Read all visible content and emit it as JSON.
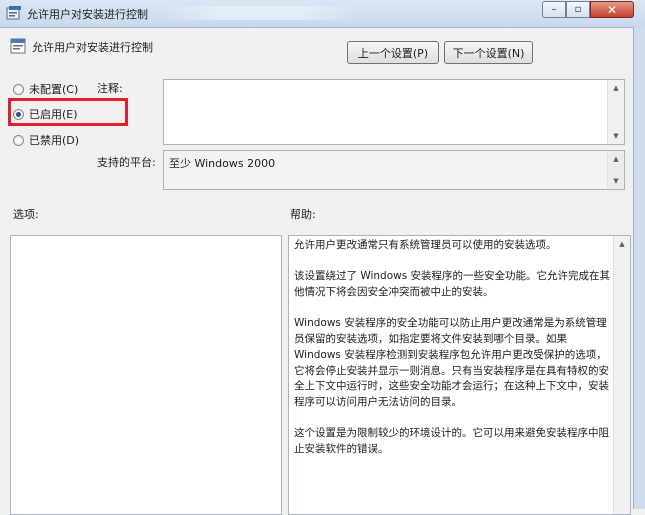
{
  "window": {
    "title": "允许用户对安装进行控制",
    "controls": {
      "minimize": "–",
      "maximize": "▫",
      "close": "✕"
    }
  },
  "header": {
    "title": "允许用户对安装进行控制",
    "prev_button": "上一个设置(P)",
    "next_button": "下一个设置(N)"
  },
  "state": {
    "options": [
      {
        "label": "未配置(C)",
        "selected": false
      },
      {
        "label": "已启用(E)",
        "selected": true
      },
      {
        "label": "已禁用(D)",
        "selected": false
      }
    ]
  },
  "comment": {
    "label": "注释:",
    "value": ""
  },
  "platform": {
    "label": "支持的平台:",
    "value": "至少 Windows 2000"
  },
  "options_panel": {
    "label": "选项:"
  },
  "help": {
    "label": "帮助:",
    "paragraphs": [
      "允许用户更改通常只有系统管理员可以使用的安装选项。",
      "该设置绕过了 Windows 安装程序的一些安全功能。它允许完成在其他情况下将会因安全冲突而被中止的安装。",
      "Windows 安装程序的安全功能可以防止用户更改通常是为系统管理员保留的安装选项，如指定要将文件安装到哪个目录。如果 Windows 安装程序检测到安装程序包允许用户更改受保护的选项，它将会停止安装并显示一则消息。只有当安装程序是在具有特权的安全上下文中运行时，这些安全功能才会运行；在这种上下文中，安装程序可以访问用户无法访问的目录。",
      "这个设置是为限制较少的环境设计的。它可以用来避免安装程序中阻止安装软件的错误。"
    ]
  },
  "colors": {
    "highlight": "#e0202a",
    "titlebar": "#c9d9ec"
  }
}
